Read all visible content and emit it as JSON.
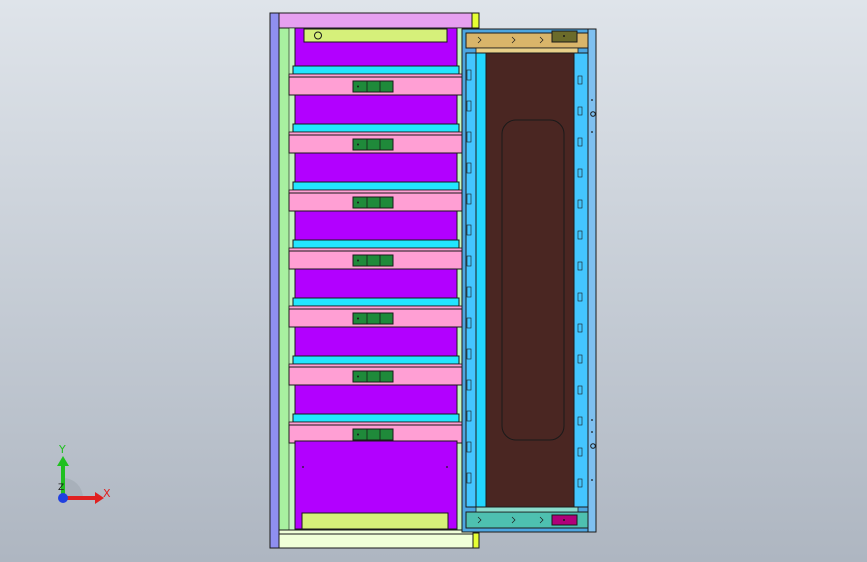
{
  "viewport": {
    "background_top": "#dfe4ea",
    "background_bottom": "#aeb6c1"
  },
  "colors": {
    "outline": "#1a1a1a",
    "side_panel": "#8f8ff0",
    "top_cap": "#e6a0f0",
    "lime": "#d6f07a",
    "light_green": "#a8f0a0",
    "drawer_purple": "#b200ff",
    "cyan": "#22e6ff",
    "pink": "#ff9fd4",
    "handle_green": "#1f8a3a",
    "yellow_strip": "#e6ff33",
    "bottom_cap": "#f0ffd8",
    "door_frame": "#4da6e0",
    "door_inner_frame": "#44c6ff",
    "door_panel": "#4a2622",
    "door_top_bar": "#d9b56a",
    "door_bottom_bar": "#4ec0b0",
    "top_hinge": "#6b6b2a",
    "bottom_hinge": "#b0007a"
  },
  "drawer_count": 7,
  "triad": {
    "icon": "coordinate-triad-icon",
    "x_label": "X",
    "y_label": "Y",
    "z_label": "Z",
    "x_color": "#e02020",
    "y_color": "#20c020",
    "z_color": "#2040e0"
  }
}
